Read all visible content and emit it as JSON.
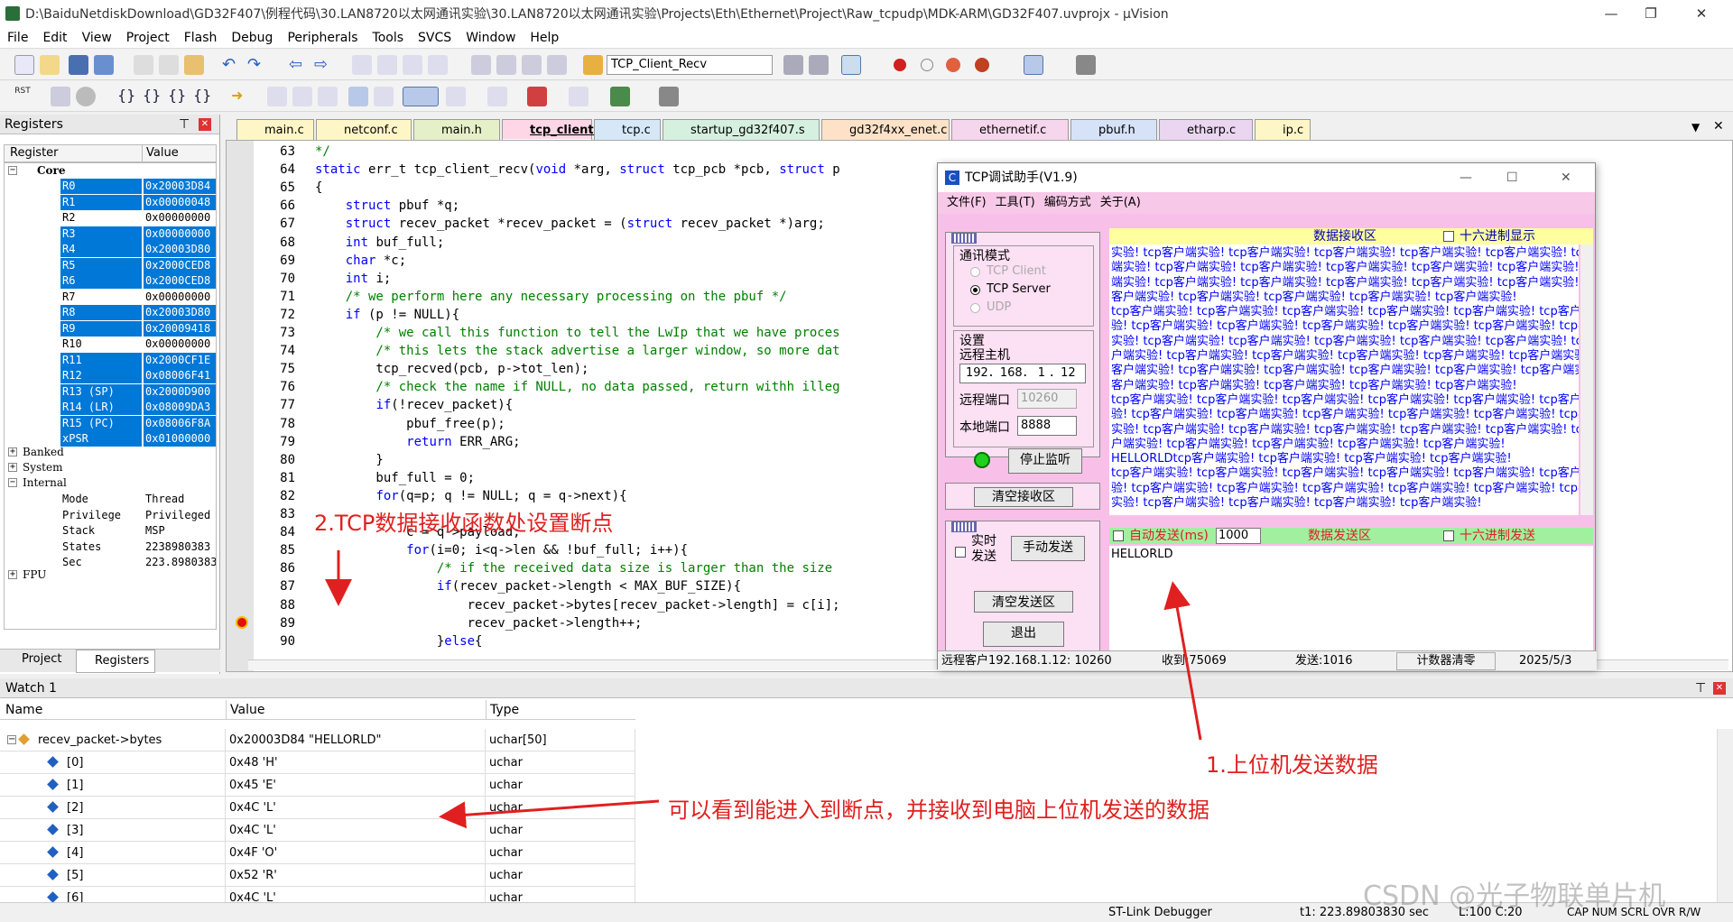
{
  "window": {
    "title": "D:\\BaiduNetdiskDownload\\GD32F407\\例程代码\\30.LAN8720以太网通讯实验\\30.LAN8720以太网通讯实验\\Projects\\Eth\\Ethernet\\Project\\Raw_tcpudp\\MDK-ARM\\GD32F407.uvprojx - µVision",
    "minimize": "—",
    "maximize": "❐",
    "close": "✕"
  },
  "menu": [
    "File",
    "Edit",
    "View",
    "Project",
    "Flash",
    "Debug",
    "Peripherals",
    "Tools",
    "SVCS",
    "Window",
    "Help"
  ],
  "toolbar": {
    "function_combo": "TCP_Client_Recv"
  },
  "registers": {
    "title": "Registers",
    "pin": "⊤",
    "close": "✕",
    "col_register": "Register",
    "col_value": "Value",
    "groups": [
      {
        "name": "Core"
      },
      {
        "name": "Banked"
      },
      {
        "name": "System"
      },
      {
        "name": "Internal"
      },
      {
        "name": "FPU"
      }
    ],
    "core": [
      {
        "name": "R0",
        "value": "0x20003D84",
        "sel": true
      },
      {
        "name": "R1",
        "value": "0x00000048",
        "sel": true
      },
      {
        "name": "R2",
        "value": "0x00000000",
        "sel": false
      },
      {
        "name": "R3",
        "value": "0x00000000",
        "sel": true
      },
      {
        "name": "R4",
        "value": "0x20003D80",
        "sel": true
      },
      {
        "name": "R5",
        "value": "0x2000CED8",
        "sel": true
      },
      {
        "name": "R6",
        "value": "0x2000CED8",
        "sel": true
      },
      {
        "name": "R7",
        "value": "0x00000000",
        "sel": false
      },
      {
        "name": "R8",
        "value": "0x20003D80",
        "sel": true
      },
      {
        "name": "R9",
        "value": "0x20009418",
        "sel": true
      },
      {
        "name": "R10",
        "value": "0x00000000",
        "sel": false
      },
      {
        "name": "R11",
        "value": "0x2000CF1E",
        "sel": true
      },
      {
        "name": "R12",
        "value": "0x08006F41",
        "sel": true
      },
      {
        "name": "R13 (SP)",
        "value": "0x2000D900",
        "sel": true
      },
      {
        "name": "R14 (LR)",
        "value": "0x08009DA3",
        "sel": true
      },
      {
        "name": "R15 (PC)",
        "value": "0x08006F8A",
        "sel": true
      },
      {
        "name": "xPSR",
        "value": "0x01000000",
        "sel": true
      }
    ],
    "internal": [
      {
        "name": "Mode",
        "value": "Thread"
      },
      {
        "name": "Privilege",
        "value": "Privileged"
      },
      {
        "name": "Stack",
        "value": "MSP"
      },
      {
        "name": "States",
        "value": "2238980383"
      },
      {
        "name": "Sec",
        "value": "223.8980383"
      }
    ],
    "tab_project": "Project",
    "tab_registers": "Registers"
  },
  "tabs": [
    {
      "label": "main.c",
      "color": "#fff6c8",
      "active": false
    },
    {
      "label": "netconf.c",
      "color": "#fff6c8",
      "active": false
    },
    {
      "label": "main.h",
      "color": "#e6f0c8",
      "active": false
    },
    {
      "label": "tcp_client.c",
      "color": "#ffd6e6",
      "active": true
    },
    {
      "label": "tcp.c",
      "color": "#d6e8f8",
      "active": false
    },
    {
      "label": "startup_gd32f407.s",
      "color": "#d6f0e0",
      "active": false
    },
    {
      "label": "gd32f4xx_enet.c",
      "color": "#fde2c8",
      "active": false
    },
    {
      "label": "ethernetif.c",
      "color": "#f6d6ec",
      "active": false
    },
    {
      "label": "pbuf.h",
      "color": "#d6e2f8",
      "active": false
    },
    {
      "label": "etharp.c",
      "color": "#ead6f0",
      "active": false
    },
    {
      "label": "ip.c",
      "color": "#fff6c8",
      "active": false
    }
  ],
  "code": [
    {
      "n": "63",
      "t": "*/",
      "c": "cm"
    },
    {
      "n": "64",
      "t": "static err_t tcp_client_recv(void *arg, struct tcp_pcb *pcb, struct p",
      "c": ""
    },
    {
      "n": "65",
      "t": "{",
      "c": ""
    },
    {
      "n": "66",
      "t": "    struct pbuf *q;",
      "c": ""
    },
    {
      "n": "67",
      "t": "    struct recev_packet *recev_packet = (struct recev_packet *)arg;",
      "c": ""
    },
    {
      "n": "68",
      "t": "    int buf_full;",
      "c": ""
    },
    {
      "n": "69",
      "t": "    char *c;",
      "c": ""
    },
    {
      "n": "70",
      "t": "    int i;",
      "c": ""
    },
    {
      "n": "71",
      "t": "    /* we perform here any necessary processing on the pbuf */",
      "c": "cm"
    },
    {
      "n": "72",
      "t": "    if (p != NULL){",
      "c": ""
    },
    {
      "n": "73",
      "t": "        /* we call this function to tell the LwIp that we have proces",
      "c": "cm"
    },
    {
      "n": "74",
      "t": "        /* this lets the stack advertise a larger window, so more dat",
      "c": "cm"
    },
    {
      "n": "75",
      "t": "        tcp_recved(pcb, p->tot_len);",
      "c": ""
    },
    {
      "n": "76",
      "t": "        /* check the name if NULL, no data passed, return withh illeg",
      "c": "cm"
    },
    {
      "n": "77",
      "t": "        if(!recev_packet){",
      "c": ""
    },
    {
      "n": "78",
      "t": "            pbuf_free(p);",
      "c": ""
    },
    {
      "n": "79",
      "t": "            return ERR_ARG;",
      "c": ""
    },
    {
      "n": "80",
      "t": "        }",
      "c": ""
    },
    {
      "n": "81",
      "t": "        buf_full = 0;",
      "c": ""
    },
    {
      "n": "82",
      "t": "        for(q=p; q != NULL; q = q->next){",
      "c": ""
    },
    {
      "n": "83",
      "t": "",
      "c": ""
    },
    {
      "n": "84",
      "t": "            c = q->payload;",
      "c": ""
    },
    {
      "n": "85",
      "t": "            for(i=0; i<q->len && !buf_full; i++){",
      "c": ""
    },
    {
      "n": "86",
      "t": "                /* if the received data size is larger than the size",
      "c": "cm"
    },
    {
      "n": "87",
      "t": "                if(recev_packet->length < MAX_BUF_SIZE){",
      "c": ""
    },
    {
      "n": "88",
      "t": "                    recev_packet->bytes[recev_packet->length] = c[i];",
      "c": ""
    },
    {
      "n": "89",
      "t": "                    recev_packet->length++;",
      "c": ""
    },
    {
      "n": "90",
      "t": "                }else{",
      "c": ""
    }
  ],
  "tcp": {
    "title": "TCP调试助手(V1.9)",
    "menu": [
      "文件(F)",
      "工具(T)",
      "编码方式",
      "关于(A)"
    ],
    "mode_label": "通讯模式",
    "modes": [
      {
        "label": "TCP Client",
        "checked": false,
        "enabled": false
      },
      {
        "label": "TCP Server",
        "checked": true,
        "enabled": true
      },
      {
        "label": "UDP",
        "checked": false,
        "enabled": false
      }
    ],
    "settings_label": "设置",
    "remote_host_label": "远程主机",
    "remote_host": "192．168． 1 ．12",
    "remote_port_label": "远程端口",
    "remote_port": "10260",
    "local_port_label": "本地端口",
    "local_port": "8888",
    "stop_btn": "停止监听",
    "clear_recv_btn": "清空接收区",
    "recv_header": "数据接收区",
    "hex_display": "十六进制显示",
    "recv_lines": [
      "实验! tcp客户端实验! tcp客户端实验! tcp客户端实验! tcp客户端实验! tcp客户端实验! tcp客户",
      "端实验! tcp客户端实验! tcp客户端实验! tcp客户端实验! tcp客户端实验! tcp客户端实验! tcp客户",
      "端实验! tcp客户端实验! tcp客户端实验! tcp客户端实验! tcp客户端实验! tcp客户端实验! tcp",
      "客户端实验! tcp客户端实验! tcp客户端实验! tcp客户端实验! tcp客户端实验!",
      " tcp客户端实验! tcp客户端实验! tcp客户端实验! tcp客户端实验! tcp客户端实验! tcp客户端实",
      "验! tcp客户端实验! tcp客户端实验! tcp客户端实验! tcp客户端实验! tcp客户端实验! tcp客户端",
      "实验! tcp客户端实验! tcp客户端实验! tcp客户端实验! tcp客户端实验! tcp客户端实验! tcp客",
      "户端实验! tcp客户端实验! tcp客户端实验! tcp客户端实验! tcp客户端实验! tcp客户端实验! tcp",
      "客户端实验! tcp客户端实验! tcp客户端实验! tcp客户端实验! tcp客户端实验! tcp客户端实验! tcp",
      "客户端实验! tcp客户端实验! tcp客户端实验! tcp客户端实验! tcp客户端实验!",
      " tcp客户端实验! tcp客户端实验! tcp客户端实验! tcp客户端实验! tcp客户端实验! tcp客户端实",
      "验! tcp客户端实验! tcp客户端实验! tcp客户端实验! tcp客户端实验! tcp客户端实验! tcp客户端",
      "实验! tcp客户端实验! tcp客户端实验! tcp客户端实验! tcp客户端实验! tcp客户端实验! tcp客",
      "户端实验! tcp客户端实验! tcp客户端实验! tcp客户端实验! tcp客户端实验!",
      " HELLORLDtcp客户端实验! tcp客户端实验! tcp客户端实验! tcp客户端实验!",
      " tcp客户端实验! tcp客户端实验! tcp客户端实验! tcp客户端实验! tcp客户端实验! tcp客户端实",
      "验! tcp客户端实验! tcp客户端实验! tcp客户端实验! tcp客户端实验! tcp客户端实验! tcp客户端",
      "实验! tcp客户端实验! tcp客户端实验! tcp客户端实验! tcp客户端实验!"
    ],
    "realtime_send": "实时发送",
    "manual_send_btn": "手动发送",
    "clear_send_btn": "清空发送区",
    "exit_btn": "退出",
    "auto_send_label": "自动发送(ms)",
    "auto_send_ms": "1000",
    "send_header": "数据发送区",
    "hex_send": "十六进制发送",
    "send_text": "HELLORLD",
    "status_remote": "远程客户192.168.1.12:  10260",
    "status_recv": "收到:75069",
    "status_sent": "发送:1016",
    "status_clear": "计数器清零",
    "status_date": "2025/5/3"
  },
  "watch": {
    "title": "Watch 1",
    "col_name": "Name",
    "col_value": "Value",
    "col_type": "Type",
    "rows": [
      {
        "name": "recev_packet->bytes",
        "value": "0x20003D84 \"HELLORLD\"",
        "type": "uchar[50]"
      },
      {
        "name": "[0]",
        "value": "0x48 'H'",
        "type": "uchar"
      },
      {
        "name": "[1]",
        "value": "0x45 'E'",
        "type": "uchar"
      },
      {
        "name": "[2]",
        "value": "0x4C 'L'",
        "type": "uchar"
      },
      {
        "name": "[3]",
        "value": "0x4C 'L'",
        "type": "uchar"
      },
      {
        "name": "[4]",
        "value": "0x4F 'O'",
        "type": "uchar"
      },
      {
        "name": "[5]",
        "value": "0x52 'R'",
        "type": "uchar"
      },
      {
        "name": "[6]",
        "value": "0x4C 'L'",
        "type": "uchar"
      }
    ]
  },
  "annotations": {
    "breakpoint": "2.TCP数据接收函数处设置断点",
    "send": "1.上位机发送数据",
    "result": "可以看到能进入到断点，并接收到电脑上位机发送的数据"
  },
  "statusbar": {
    "debugger": "ST-Link Debugger",
    "time": "t1: 223.89803830 sec",
    "pos": "L:100 C:20",
    "caps": "CAP NUM SCRL OVR R/W"
  },
  "watermark": "CSDN @光子物联单片机"
}
